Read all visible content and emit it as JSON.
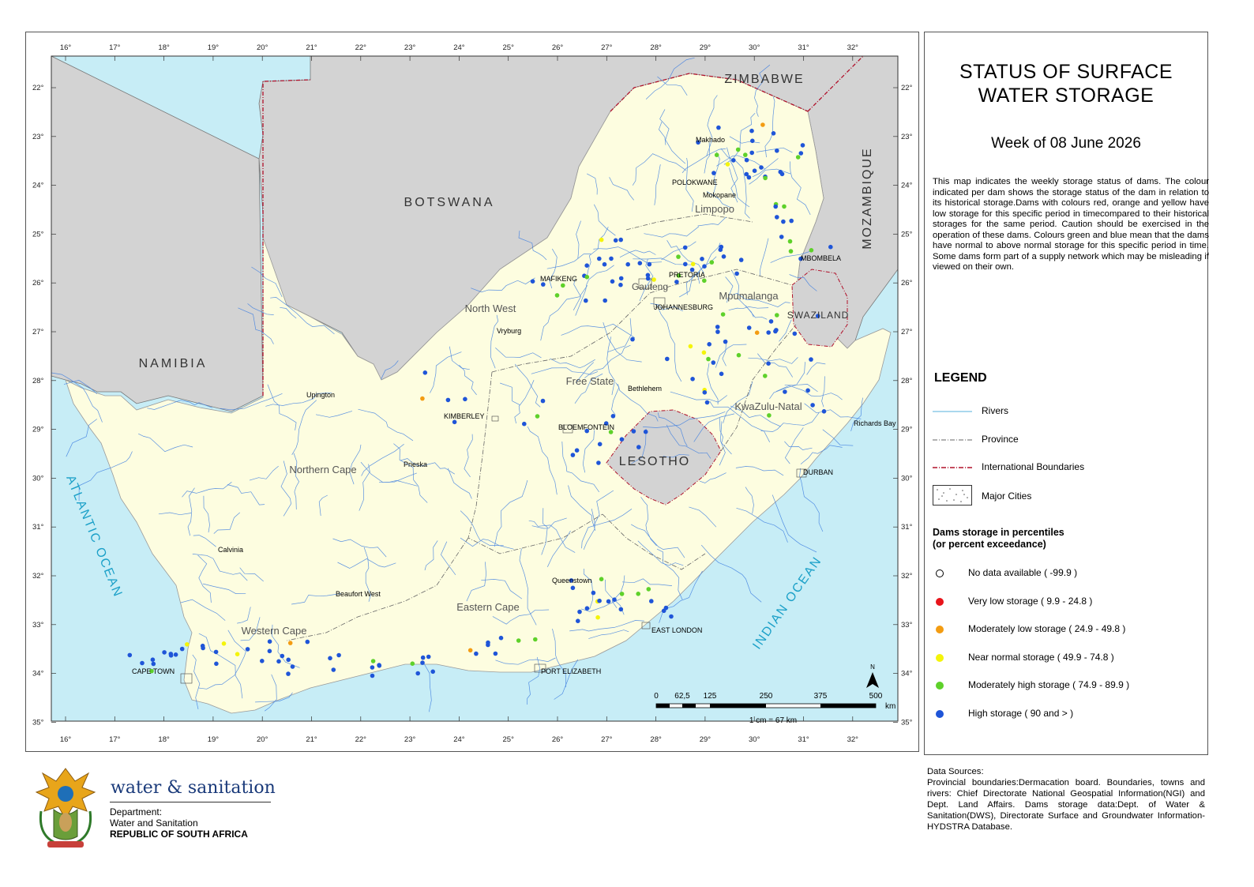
{
  "map": {
    "title_line1": "STATUS OF SURFACE",
    "title_line2": "WATER STORAGE",
    "week_label": "Week of 08 June 2026",
    "description": "This map indicates the weekly storage status of dams. The colour indicated per dam shows the storage status of the dam in relation to its historical storage.Dams with colours red, orange and yellow have low storage for this specific period in timecompared to their historical storages for the same period. Caution should be exercised in the operation of these dams. Colours green and blue mean that the dams have normal to above normal storage for this specific period in time. Some dams form part of a supply network which may be misleading if viewed on their own.",
    "longitude_ticks": [
      "16°",
      "17°",
      "18°",
      "19°",
      "20°",
      "21°",
      "22°",
      "23°",
      "24°",
      "25°",
      "26°",
      "27°",
      "28°",
      "29°",
      "30°",
      "31°",
      "32°"
    ],
    "latitude_ticks": [
      "22°",
      "23°",
      "24°",
      "25°",
      "26°",
      "27°",
      "28°",
      "29°",
      "30°",
      "31°",
      "32°",
      "33°",
      "34°",
      "35°"
    ],
    "countries": {
      "zimbabwe": "ZIMBABWE",
      "botswana": "BOTSWANA",
      "namibia": "NAMIBIA",
      "mozambique": "MOZAMBIQUE",
      "lesotho": "LESOTHO",
      "swaziland": "SWAZILAND"
    },
    "oceans": {
      "atlantic": "ATLANTIC OCEAN",
      "indian": "INDIAN OCEAN"
    },
    "provinces": {
      "limpopo": "Limpopo",
      "north_west": "North West",
      "gauteng": "Gauteng",
      "mpumalanga": "Mpumalanga",
      "free_state": "Free State",
      "kwazulu_natal": "KwaZulu-Natal",
      "northern_cape": "Northern Cape",
      "eastern_cape": "Eastern Cape",
      "western_cape": "Western Cape"
    },
    "cities": {
      "makhado": "Makhado",
      "polokwane": "POLOKWANE",
      "mokopane": "Mokopane",
      "mbombela": "MBOMBELA",
      "pretoria": "PRETORIA",
      "johannesburg": "JOHANNESBURG",
      "mafikeng": "MAFIKENG",
      "vryburg": "Vryburg",
      "upington": "Upington",
      "kimberley": "KIMBERLEY",
      "bloemfontein": "BLOEMFONTEIN",
      "bethlehem": "Bethlehem",
      "richards_bay": "Richards Bay",
      "durban": "DURBAN",
      "prieska": "Prieska",
      "calvinia": "Calvinia",
      "queenstown": "Queenstown",
      "beaufort_west": "Beaufort West",
      "east_london": "EAST LONDON",
      "cape_town": "CAPE TOWN",
      "port_elizabeth": "PORT ELIZABETH"
    },
    "scale": {
      "ticks": [
        "0",
        "62,5",
        "125",
        "250",
        "375",
        "500"
      ],
      "unit": "km",
      "ratio": "1 cm = 67 km",
      "north": "N"
    }
  },
  "legend": {
    "title": "LEGEND",
    "rivers": "Rivers",
    "province": "Province",
    "international": "International Boundaries",
    "major_cities": "Major Cities",
    "dams_title_line1": "Dams storage in percentiles",
    "dams_title_line2": "(or percent exceedance)",
    "categories": [
      {
        "label": "No data available ( -99.9 )",
        "color": "#ffffff"
      },
      {
        "label": "Very low storage ( 9.9 - 24.8 )",
        "color": "#e8141b"
      },
      {
        "label": "Moderately low storage ( 24.9 - 49.8 )",
        "color": "#f39c12"
      },
      {
        "label": "Near normal storage ( 49.9 - 74.8 )",
        "color": "#f4f40a"
      },
      {
        "label": "Moderately high storage ( 74.9 - 89.9 )",
        "color": "#5ed12a"
      },
      {
        "label": "High storage ( 90 and > )",
        "color": "#1f55d8"
      }
    ]
  },
  "data_sources": {
    "heading": "Data Sources:",
    "text": "Provincial boundaries:Dermacation board. Boundaries, towns and rivers: Chief Directorate National Geospatial Information(NGI) and Dept. Land Affairs. Dams storage data:Dept. of Water & Sanitation(DWS), Directorate Surface and Groundwater Information-HYDSTRA Database."
  },
  "department": {
    "brand": "water & sanitation",
    "line1": "Department:",
    "line2": "Water and Sanitation",
    "line3": "REPUBLIC OF SOUTH AFRICA"
  },
  "colors": {
    "land": "#fdfde0",
    "neighbour": "#d3d3d3",
    "ocean": "#c7edf6",
    "river": "#3f7fe0",
    "boundary": "#b0102a"
  }
}
